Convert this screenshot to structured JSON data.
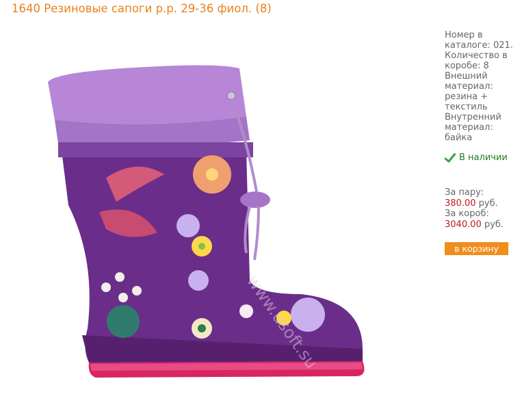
{
  "product": {
    "title": "1640 Резиновые сапоги р.р. 29-36 фиол. (8)",
    "image_alt": "rubber boot with drawstring cuff",
    "watermark": "www.usoft.su"
  },
  "specs": {
    "text": "Номер в каталоге: 021.\nКоличество в коробе: 8\nВнешний материал: резина + текстиль\nВнутренний материал: байка"
  },
  "stock": {
    "icon": "checkmark-icon",
    "label": "В наличии",
    "color": "#1f7a1f"
  },
  "pricing": {
    "pair_label": "За пару:",
    "pair_price": "380.00",
    "pair_currency": "руб.",
    "box_label": "За короб:",
    "box_price": "3040.00",
    "box_currency": "руб.",
    "price_color": "#c0191c"
  },
  "cart": {
    "button_label": "в корзину",
    "button_color": "#ef8d1d"
  },
  "theme": {
    "title_color": "#e8821c"
  }
}
